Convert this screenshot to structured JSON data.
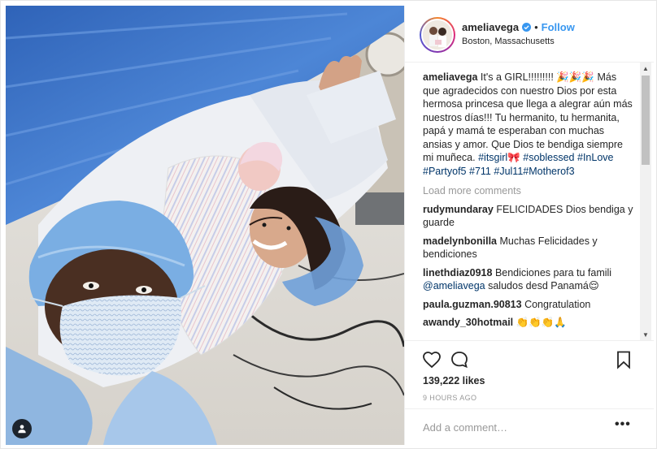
{
  "colors": {
    "link_blue": "#3897f0",
    "hashtag_blue": "#003569",
    "text_dark": "#262626",
    "text_muted": "#999999",
    "border": "#efefef"
  },
  "photo": {
    "description_icon": "user-tag-icon"
  },
  "header": {
    "username": "ameliavega",
    "verified_icon": "verified-badge-icon",
    "separator": "•",
    "follow_label": "Follow",
    "location": "Boston, Massachusetts"
  },
  "caption": {
    "username": "ameliavega",
    "text": "It's a GIRL!!!!!!!!! 🎉🎉🎉 Más que agradecidos con nuestro Dios por esta hermosa princesa que llega a alegrar aún más nuestros días!!! Tu hermanito, tu hermanita, papá y mamá te esperaban con muchas ansias y amor. Que Dios te bendiga siempre mi muñeca.",
    "hashtags": [
      "#itsgirl🎀",
      "#soblessed",
      "#InLove",
      "#Partyof5",
      "#711",
      "#Jul11#Motherof3"
    ]
  },
  "load_more": "Load more comments",
  "comments": [
    {
      "user": "rudymundaray",
      "text": "FELICIDADES Dios bendiga y guarde"
    },
    {
      "user": "madelynbonilla",
      "text": "Muchas Felicidades y bendiciones"
    },
    {
      "user": "linethdiaz0918",
      "text": "Bendiciones para tu famili",
      "mention": "@ameliavega",
      "text2": "saludos desd Panamá😌"
    },
    {
      "user": "paula.guzman.90813",
      "text": "Congratulation"
    },
    {
      "user": "awandy_30hotmail",
      "text": "👏👏👏🙏"
    }
  ],
  "actions": {
    "like_icon": "heart-icon",
    "comment_icon": "comment-bubble-icon",
    "save_icon": "bookmark-icon"
  },
  "likes": "139,222 likes",
  "timestamp": "9 HOURS AGO",
  "add_comment": {
    "placeholder": "Add a comment…",
    "more_label": "•••"
  },
  "scrollbar": {
    "up_glyph": "▲",
    "down_glyph": "▼"
  }
}
